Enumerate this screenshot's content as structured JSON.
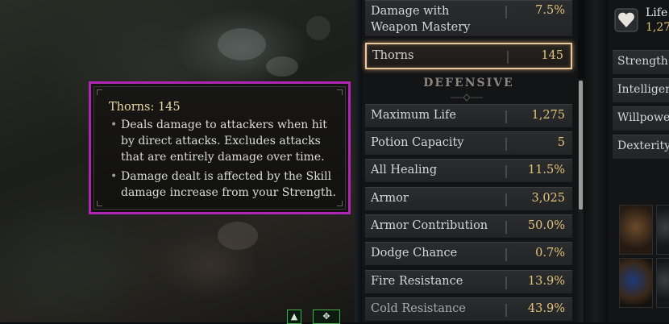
{
  "tooltip": {
    "title": "Thorns: 145",
    "bullets": [
      "Deals damage to attackers when hit by direct attacks. Excludes attacks that are entirely damage over time.",
      "Damage dealt is affected by the Skill damage increase from your Strength."
    ]
  },
  "stats_panel": {
    "top_rows": [
      {
        "label": "Damage with Weapon Mastery",
        "value": "7.5%"
      },
      {
        "label": "Thorns",
        "value": "145"
      }
    ],
    "section_heading": "DEFENSIVE",
    "defensive_rows": [
      {
        "label": "Maximum Life",
        "value": "1,275"
      },
      {
        "label": "Potion Capacity",
        "value": "5"
      },
      {
        "label": "All Healing",
        "value": "11.5%"
      },
      {
        "label": "Armor",
        "value": "3,025"
      },
      {
        "label": "Armor Contribution",
        "value": "50.0%"
      },
      {
        "label": "Dodge Chance",
        "value": "0.7%"
      },
      {
        "label": "Fire Resistance",
        "value": "13.9%"
      },
      {
        "label": "Cold Resistance",
        "value": "43.9%"
      }
    ],
    "selected_row": "Thorns"
  },
  "character_panel": {
    "life_label": "Life",
    "life_value": "1,27",
    "attributes": [
      "Strength",
      "Intelligen",
      "Willpower",
      "Dexterity"
    ]
  },
  "hud": {
    "icons": [
      "arrow-up-icon",
      "cross-icon"
    ]
  },
  "colors": {
    "tooltip_border": "#b026b4",
    "value_gold": "#e3c27a",
    "selected_outline": "#e9c9a0"
  }
}
